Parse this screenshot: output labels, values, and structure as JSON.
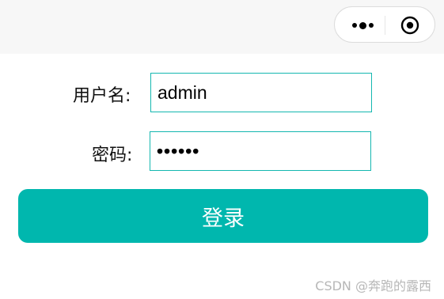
{
  "topbar": {
    "menu_icon": "more-dots-icon",
    "close_icon": "target-close-icon"
  },
  "form": {
    "username_label": "用户名:",
    "username_value": "admin",
    "password_label": "密码:",
    "password_value": "••••••"
  },
  "actions": {
    "login_label": "登录"
  },
  "footer": {
    "watermark": "CSDN @奔跑的露西"
  },
  "colors": {
    "accent": "#00b7ae",
    "input_border": "#14b7b0",
    "topbar_bg": "#f7f7f7"
  }
}
